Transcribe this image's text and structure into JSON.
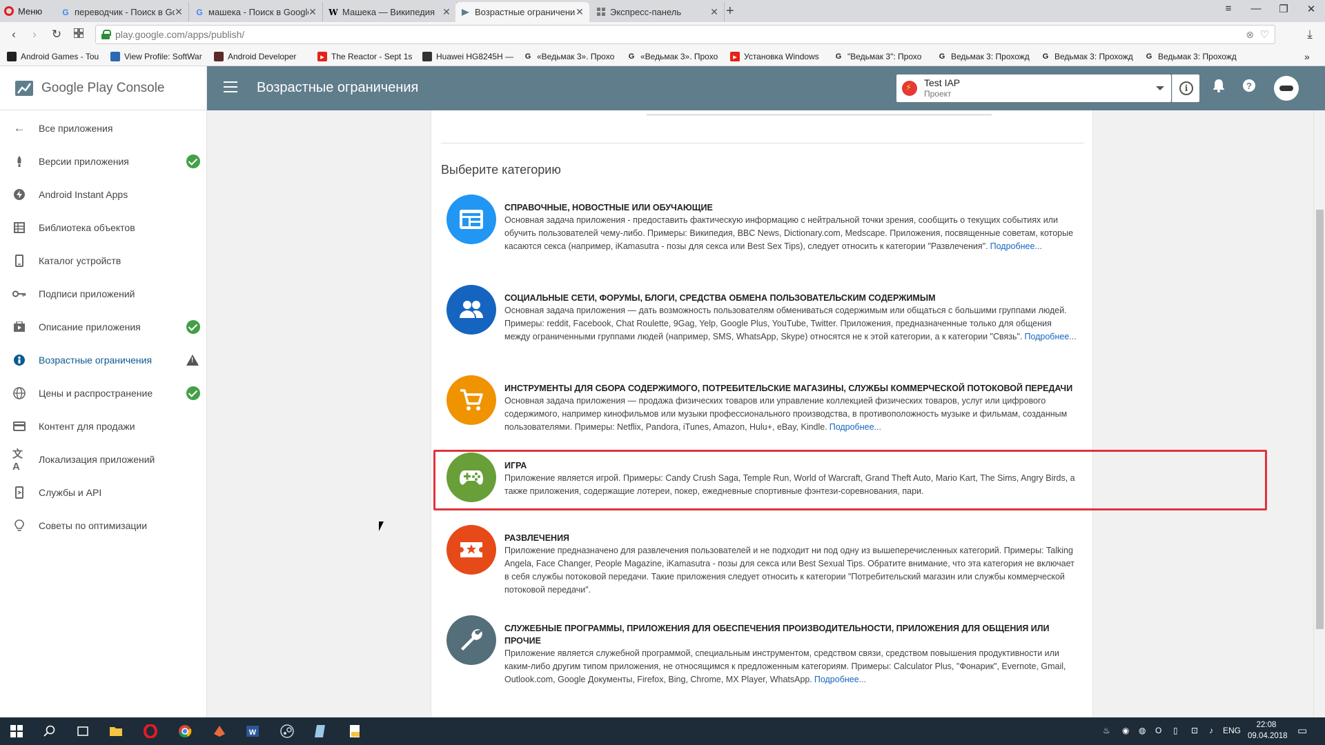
{
  "browser": {
    "menu_label": "Меню",
    "tabs": [
      {
        "title": "переводчик - Поиск в Go",
        "icon": "google-icon"
      },
      {
        "title": "машека - Поиск в Google",
        "icon": "google-icon"
      },
      {
        "title": "Машека — Википедия",
        "icon": "wikipedia-icon"
      },
      {
        "title": "Возрастные ограничения",
        "icon": "play-console-icon",
        "active": true
      },
      {
        "title": "Экспресс-панель",
        "icon": "speed-dial-icon"
      }
    ],
    "url": "play.google.com/apps/publish/",
    "bookmarks": [
      {
        "label": "Android Games - Tou",
        "icon": "bookmark-icon"
      },
      {
        "label": "View Profile: SoftWar",
        "icon": "bookmark-icon"
      },
      {
        "label": "Android Developer",
        "icon": "bookmark-icon"
      },
      {
        "label": "The Reactor - Sept 1s",
        "icon": "youtube-icon"
      },
      {
        "label": "Huawei HG8245H —",
        "icon": "bookmark-icon"
      },
      {
        "label": "«Ведьмак 3». Прохо",
        "icon": "google-icon"
      },
      {
        "label": "«Ведьмак 3». Прохо",
        "icon": "google-icon"
      },
      {
        "label": "Установка Windows",
        "icon": "youtube-icon"
      },
      {
        "label": "\"Ведьмак 3\": Прохо",
        "icon": "google-icon"
      },
      {
        "label": "Ведьмак 3: Прохожд",
        "icon": "google-icon"
      },
      {
        "label": "Ведьмак 3: Прохожд",
        "icon": "google-icon"
      },
      {
        "label": "Ведьмак 3: Прохожд",
        "icon": "google-icon"
      }
    ]
  },
  "sidebar": {
    "brand": "Google Play Console",
    "back_label": "Все приложения",
    "items": [
      {
        "label": "Версии приложения",
        "icon": "rocket-icon",
        "status": "ok"
      },
      {
        "label": "Android Instant Apps",
        "icon": "lightning-icon",
        "status": ""
      },
      {
        "label": "Библиотека объектов",
        "icon": "grid-icon",
        "status": ""
      },
      {
        "label": "Каталог устройств",
        "icon": "device-icon",
        "status": ""
      },
      {
        "label": "Подписи приложений",
        "icon": "key-icon",
        "status": ""
      },
      {
        "label": "Описание приложения",
        "icon": "store-listing-icon",
        "status": "ok"
      },
      {
        "label": "Возрастные ограничения",
        "icon": "content-rating-icon",
        "status": "warning",
        "active": true
      },
      {
        "label": "Цены и распространение",
        "icon": "globe-icon",
        "status": "ok"
      },
      {
        "label": "Контент для продажи",
        "icon": "card-icon",
        "status": ""
      },
      {
        "label": "Локализация приложений",
        "icon": "translate-icon",
        "status": ""
      },
      {
        "label": "Службы и API",
        "icon": "services-icon",
        "status": ""
      },
      {
        "label": "Советы по оптимизации",
        "icon": "lightbulb-icon",
        "status": ""
      }
    ]
  },
  "header": {
    "title": "Возрастные ограничения",
    "project_name": "Test IAP",
    "project_sub": "Проект"
  },
  "main": {
    "section_title": "Выберите категорию",
    "categories": [
      {
        "title": "СПРАВОЧНЫЕ, НОВОСТНЫЕ ИЛИ ОБУЧАЮЩИЕ",
        "text": "Основная задача приложения - предоставить фактическую информацию с нейтральной точки зрения, сообщить о текущих событиях или обучить пользователей чему-либо. Примеры: Википедия, BBC News, Dictionary.com, Medscape. Приложения, посвященные советам, которые касаются секса (например, iKamasutra - позы для секса или Best Sex Tips), следует относить к категории \"Развлечения\".",
        "more": "Подробнее...",
        "icon": "reference-icon",
        "color": "#2196f3"
      },
      {
        "title": "СОЦИАЛЬНЫЕ СЕТИ, ФОРУМЫ, БЛОГИ, СРЕДСТВА ОБМЕНА ПОЛЬЗОВАТЕЛЬСКИМ СОДЕРЖИМЫМ",
        "text": "Основная задача приложения — дать возможность пользователям обмениваться содержимым или общаться с большими группами людей. Примеры: reddit, Facebook, Chat Roulette, 9Gag, Yelp, Google Plus, YouTube, Twitter. Приложения, предназначенные только для общения между ограниченными группами людей (например, SMS, WhatsApp, Skype) относятся не к этой категории, а к категории \"Связь\".",
        "more": "Подробнее...",
        "icon": "people-icon",
        "color": "#1565c0"
      },
      {
        "title": "ИНСТРУМЕНТЫ ДЛЯ СБОРА СОДЕРЖИМОГО, ПОТРЕБИТЕЛЬСКИЕ МАГАЗИНЫ, СЛУЖБЫ КОММЕРЧЕСКОЙ ПОТОКОВОЙ ПЕРЕДАЧИ",
        "text": "Основная задача приложения — продажа физических товаров или управление коллекцией физических товаров, услуг или цифрового содержимого, например кинофильмов или музыки профессионального производства, в противоположность музыке и фильмам, созданным пользователями. Примеры: Netflix, Pandora, iTunes, Amazon, Hulu+, eBay, Kindle.",
        "more": "Подробнее...",
        "icon": "cart-icon",
        "color": "#f09300"
      },
      {
        "title": "ИГРА",
        "text": "Приложение является игрой. Примеры: Candy Crush Saga, Temple Run, World of Warcraft, Grand Theft Auto, Mario Kart, The Sims, Angry Birds, а также приложения, содержащие лотереи, покер, ежедневные спортивные фэнтези-соревнования, пари.",
        "more": "",
        "icon": "gamepad-icon",
        "color": "#689f38"
      },
      {
        "title": "РАЗВЛЕЧЕНИЯ",
        "text": "Приложение предназначено для развлечения пользователей и не подходит ни под одну из вышеперечисленных категорий. Примеры: Talking Angela, Face Changer, People Magazine, iKamasutra - позы для секса или Best Sexual Tips. Обратите внимание, что эта категория не включает в себя службы потоковой передачи. Такие приложения следует относить к категории \"Потребительский магазин или службы коммерческой потоковой передачи\".",
        "more": "",
        "icon": "ticket-icon",
        "color": "#e64a19"
      },
      {
        "title": "СЛУЖЕБНЫЕ ПРОГРАММЫ, ПРИЛОЖЕНИЯ ДЛЯ ОБЕСПЕЧЕНИЯ ПРОИЗВОДИТЕЛЬНОСТИ, ПРИЛОЖЕНИЯ ДЛЯ ОБЩЕНИЯ ИЛИ ПРОЧИЕ",
        "text": "Приложение является служебной программой, специальным инструментом, средством связи, средством повышения продуктивности или каким-либо другим типом приложения, не относящимся к предложенным категориям. Примеры: Calculator Plus, \"Фонарик\", Evernote, Gmail, Outlook.com, Google Документы, Firefox, Bing, Chrome, MX Player, WhatsApp.",
        "more": "Подробнее...",
        "icon": "wrench-icon",
        "color": "#546e7a"
      }
    ]
  },
  "taskbar": {
    "lang": "ENG",
    "time": "22:08",
    "date": "09.04.2018"
  }
}
